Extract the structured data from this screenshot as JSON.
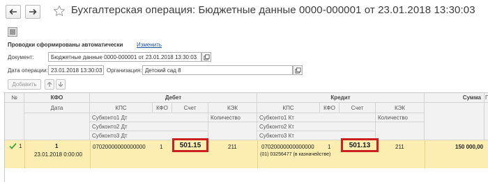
{
  "window": {
    "title": "Бухгалтерская операция: Бюджетные данные 0000-000001 от 23.01.2018 13:30:03"
  },
  "postings": {
    "label": "Проводки сформированы автоматически",
    "change_link": "Изменить"
  },
  "form": {
    "document_label": "Документ:",
    "document_value": "Бюджетные данные 0000-000001 от 23.01.2018 13:30:03",
    "date_label": "Дата операции:",
    "date_value": "23.01.2018 13:30:03",
    "org_label": "Организация:",
    "org_value": "Детский сад 8"
  },
  "toolbar": {
    "add_label": "Добавить"
  },
  "table": {
    "headers": {
      "num": "№",
      "kfo": "КФО",
      "date": "Дата",
      "debit": "Дебет",
      "credit": "Кредит",
      "sum": "Сумма",
      "kps": "КПС",
      "kfo_short": "КФО",
      "account": "Счет",
      "kek": "КЭК",
      "quantity": "Количество",
      "sub1_dt": "Субконто1 Дт",
      "sub2_dt": "Субконто2 Дт",
      "sub3_dt": "Субконто3 Дт",
      "sub1_kt": "Субконто1 Кт",
      "sub2_kt": "Субконто2 Кт",
      "sub3_kt": "Субконто3 Кт",
      "extra": "Г"
    },
    "rows": [
      {
        "num": "1",
        "kfo": "1",
        "date": "23.01.2018 0:00:00",
        "dt_kps": "07020000000000000",
        "dt_kfo": "1",
        "dt_account": "501.15",
        "dt_kek": "211",
        "kt_kps": "07020000000000000",
        "kt_kfo": "1",
        "kt_account": "501.13",
        "kt_kek": "211",
        "kt_sub1": "(01) 03256477 (в казначействе)",
        "sum": "150 000,00"
      }
    ]
  },
  "colors": {
    "selected_row": "#fbeeb0",
    "highlight_border": "#cc1f1f",
    "check": "#3aa83a"
  }
}
